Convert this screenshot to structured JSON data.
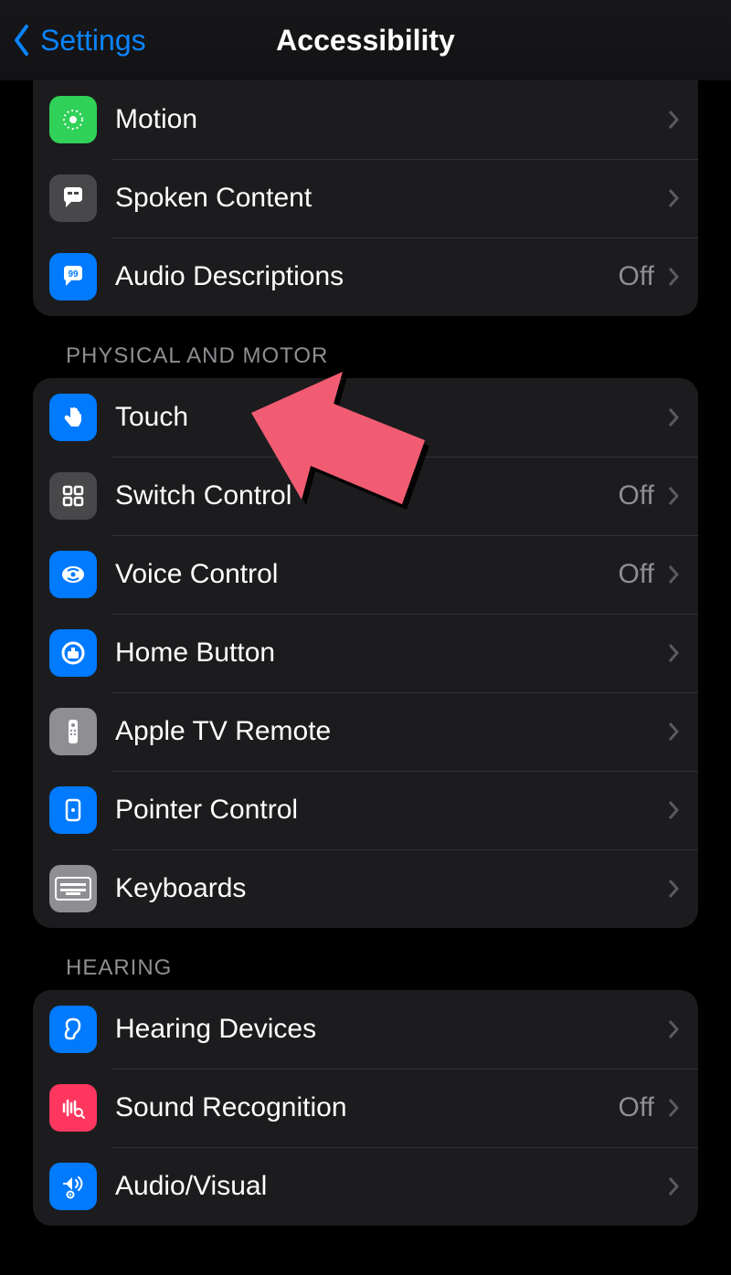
{
  "nav": {
    "back_label": "Settings",
    "title": "Accessibility"
  },
  "annotation": {
    "arrow_target": "touch-row"
  },
  "sections": [
    {
      "header": null,
      "rows": [
        {
          "id": "motion",
          "label": "Motion",
          "value": null,
          "icon": "motion-icon",
          "icon_bg": "bg-green"
        },
        {
          "id": "spoken-content",
          "label": "Spoken Content",
          "value": null,
          "icon": "speech-icon",
          "icon_bg": "bg-darkgray"
        },
        {
          "id": "audio-descriptions",
          "label": "Audio Descriptions",
          "value": "Off",
          "icon": "quotes-icon",
          "icon_bg": "bg-blue"
        }
      ]
    },
    {
      "header": "PHYSICAL AND MOTOR",
      "rows": [
        {
          "id": "touch",
          "label": "Touch",
          "value": null,
          "icon": "touch-icon",
          "icon_bg": "bg-blue"
        },
        {
          "id": "switch-control",
          "label": "Switch Control",
          "value": "Off",
          "icon": "grid-icon",
          "icon_bg": "bg-darkgray"
        },
        {
          "id": "voice-control",
          "label": "Voice Control",
          "value": "Off",
          "icon": "voice-icon",
          "icon_bg": "bg-blue"
        },
        {
          "id": "home-button",
          "label": "Home Button",
          "value": null,
          "icon": "home-icon",
          "icon_bg": "bg-blue"
        },
        {
          "id": "apple-tv-remote",
          "label": "Apple TV Remote",
          "value": null,
          "icon": "remote-icon",
          "icon_bg": "bg-gray"
        },
        {
          "id": "pointer-control",
          "label": "Pointer Control",
          "value": null,
          "icon": "pointer-icon",
          "icon_bg": "bg-blue"
        },
        {
          "id": "keyboards",
          "label": "Keyboards",
          "value": null,
          "icon": "keyboard-icon",
          "icon_bg": "bg-gray"
        }
      ]
    },
    {
      "header": "HEARING",
      "rows": [
        {
          "id": "hearing-devices",
          "label": "Hearing Devices",
          "value": null,
          "icon": "ear-icon",
          "icon_bg": "bg-blue"
        },
        {
          "id": "sound-recognition",
          "label": "Sound Recognition",
          "value": "Off",
          "icon": "sound-rec-icon",
          "icon_bg": "bg-red"
        },
        {
          "id": "audio-visual",
          "label": "Audio/Visual",
          "value": null,
          "icon": "av-icon",
          "icon_bg": "bg-blue"
        }
      ]
    }
  ]
}
